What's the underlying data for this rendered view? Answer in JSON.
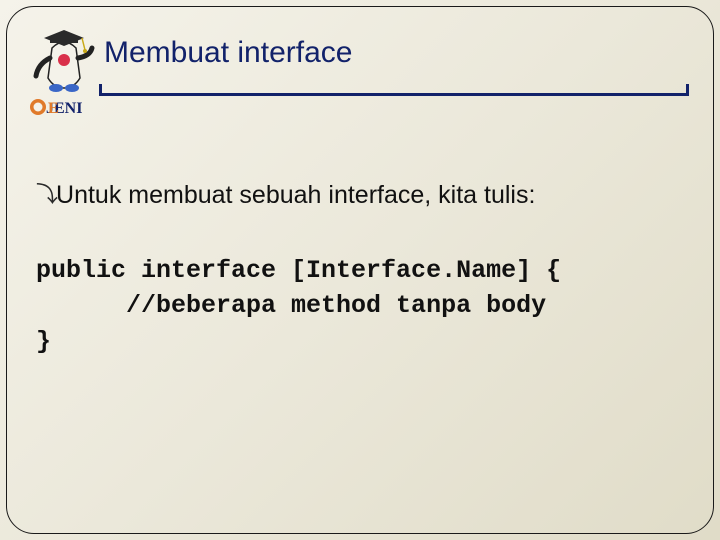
{
  "header": {
    "title": "Membuat interface"
  },
  "body": {
    "bullet_text": "Untuk membuat sebuah interface, kita tulis:",
    "code_line1": "public interface [Interface.Name] {",
    "code_line2": "      //beberapa method tanpa body",
    "code_line3": "}"
  },
  "icons": {
    "mascot": "java-duke-graduate",
    "brand": "jeni-logo"
  },
  "colors": {
    "title": "#12226a",
    "border": "#1a1a1a"
  }
}
